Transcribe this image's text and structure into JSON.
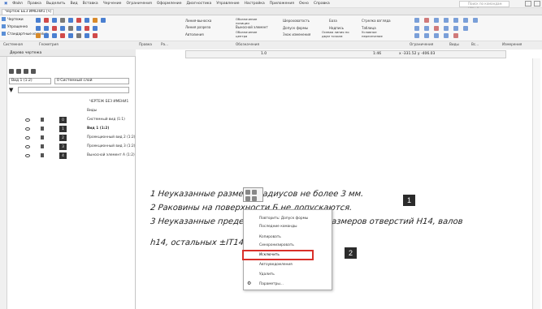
{
  "menubar": {
    "items": [
      "Файл",
      "Правка",
      "Выделить",
      "Вид",
      "Вставка",
      "Черчение",
      "Ограничения",
      "Оформление",
      "Диагностика",
      "Управление",
      "Настройка",
      "Приложения",
      "Окно",
      "Справка"
    ],
    "search_placeholder": "Поиск по командам (Alt+/)"
  },
  "tab": {
    "label": "Чертеж БЕЗ ИМЕНИ1 [ч]"
  },
  "ribbon": {
    "left": [
      "Чертежи",
      "Упрощенно",
      "Стандартные изделия"
    ],
    "labels": [
      "Линия-выноска",
      "Обозначение позиции",
      "Шероховатость",
      "База",
      "Стрелка взгляда",
      "Линия разреза",
      "Выносной элемент",
      "Автолиния",
      "Обозначение центра",
      "Допуск формы",
      "Надпись",
      "Таблица",
      "Знак изменения",
      "Осевая линия по двум точкам",
      "Условное пересечение"
    ],
    "footer": [
      "Системная",
      "Геометрия",
      "Правка",
      "Ра...",
      "Обозначения",
      "Ограничения",
      "Виды",
      "Вс...",
      "Измерения"
    ]
  },
  "panel": {
    "title": "Дерево чертежа",
    "view_combo": "Вид 1 (1:2)",
    "layer_combo": "0  Системный слой",
    "search_placeholder": "",
    "rows": [
      {
        "label": "ЧЕРТЕЖ БЕЗ ИМЕНИ1",
        "num": ""
      },
      {
        "label": "Виды",
        "num": ""
      },
      {
        "label": "Системный вид (1:1)",
        "num": "0"
      },
      {
        "label": "Вид 1 (1:2)",
        "num": "1"
      },
      {
        "label": "Проекционный вид 2 (1:2)",
        "num": "2"
      },
      {
        "label": "Проекционный вид 3 (1:2)",
        "num": "3"
      },
      {
        "label": "Выносной элемент А (1:2)",
        "num": "4"
      }
    ]
  },
  "canvas": {
    "scale": "1.0",
    "zoom": "1:46",
    "coords": "x -331.52  y -406.03",
    "notes": [
      "1 Неуказанные размеры радиусов не более 3 мм.",
      "2 Раковины на поверхности Б не допускаются.",
      "3 Неуказанные предельные отклонения размеров отверстий H14, валов",
      "h14, остальных ±IT14/2 ."
    ]
  },
  "context_menu": {
    "items": [
      "Повторить: Допуск формы",
      "Последние команды",
      "Копировать",
      "Синхронизировать",
      "Исключить",
      "Автоуведомления",
      "Удалить",
      "Параметры..."
    ],
    "highlighted": "Исключить"
  },
  "badges": [
    "1",
    "2"
  ],
  "colors": {
    "accent": "#2f6fd0",
    "highlight": "#d9302a",
    "badge": "#2b2b2b"
  }
}
